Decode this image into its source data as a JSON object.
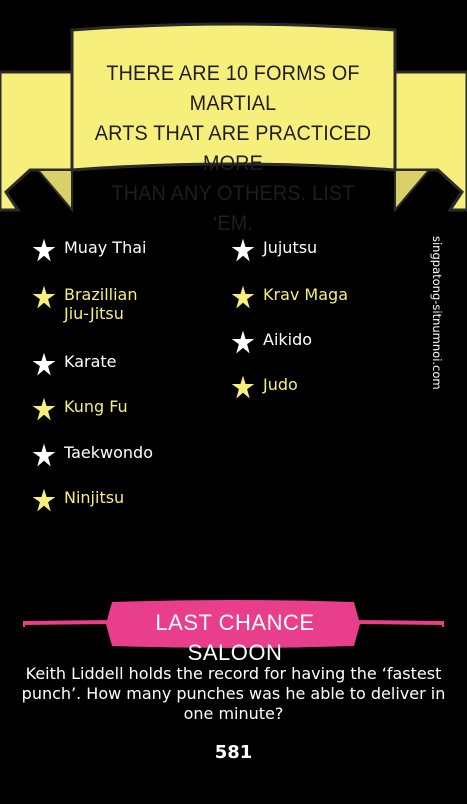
{
  "banner": {
    "text": "THERE ARE 10 FORMS OF MARTIAL\nARTS THAT ARE PRACTICED MORE\nTHAN ANY OTHERS. LIST ‘EM.",
    "ribbon_color": "#f7ef7c"
  },
  "answers": {
    "col1": [
      {
        "label": "Muay Thai",
        "color": "white"
      },
      {
        "label": "Brazillian\nJiu-Jitsu",
        "color": "yellow"
      },
      {
        "label": "Karate",
        "color": "white"
      },
      {
        "label": "Kung Fu",
        "color": "yellow"
      },
      {
        "label": "Taekwondo",
        "color": "white"
      },
      {
        "label": "Ninjitsu",
        "color": "yellow"
      }
    ],
    "col2": [
      {
        "label": "Jujutsu",
        "color": "white"
      },
      {
        "label": "Krav Maga",
        "color": "yellow"
      },
      {
        "label": "Aikido",
        "color": "white"
      },
      {
        "label": "Judo",
        "color": "yellow"
      }
    ]
  },
  "credit": "singpatong-sitnumnoi.com",
  "saloon": {
    "title": "LAST CHANCE SALOON",
    "color": "#e83e8c"
  },
  "question": "Keith Liddell holds the record for having the ‘fastest punch’. How many punches was he able to deliver in one minute?",
  "answer": "581"
}
